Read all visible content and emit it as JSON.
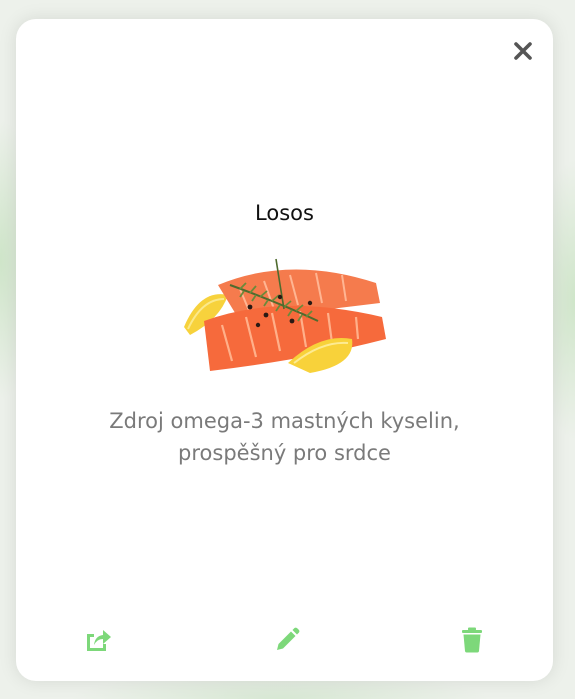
{
  "modal": {
    "title": "Losos",
    "description": "Zdroj omega-3 mastných kyselin, prospěšný pro srdce",
    "image_icon": "salmon-fillet-image"
  },
  "actions": {
    "close_icon": "close-icon",
    "share_icon": "share-icon",
    "edit_icon": "pencil-icon",
    "delete_icon": "trash-icon"
  },
  "colors": {
    "accent": "#7dd87a",
    "close": "#555555",
    "title": "#111111",
    "description": "#7a7a7a"
  }
}
